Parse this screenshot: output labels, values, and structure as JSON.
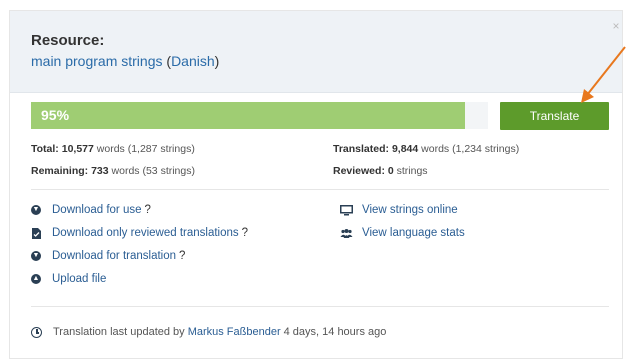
{
  "header": {
    "title": "Resource:",
    "resource_name": "main program strings",
    "language": "Danish",
    "open_paren": "(",
    "close_paren": ")",
    "close_label": "×"
  },
  "progress": {
    "percent_label": "95%",
    "percent_value": 95,
    "fill_color": "#9fcd73"
  },
  "translate_button": {
    "label": "Translate",
    "color": "#5d9b2b"
  },
  "stats": {
    "total_label": "Total:",
    "total_value": "10,577",
    "total_rest": "words (1,287 strings)",
    "remaining_label": "Remaining:",
    "remaining_value": "733",
    "remaining_rest": "words (53 strings)",
    "translated_label": "Translated:",
    "translated_value": "9,844",
    "translated_rest": "words (1,234 strings)",
    "reviewed_label": "Reviewed:",
    "reviewed_value": "0",
    "reviewed_rest": "strings"
  },
  "actions": {
    "download_use": "Download for use",
    "download_reviewed": "Download only reviewed translations",
    "download_translation": "Download for translation",
    "upload": "Upload file",
    "view_online": "View strings online",
    "view_stats": "View language stats",
    "help_mark": "?"
  },
  "footer": {
    "prefix": "Translation last updated by",
    "user": "Markus Faßbender",
    "time": "4 days, 14 hours ago"
  },
  "icons": {
    "download": "download-icon",
    "reviewed": "file-check-icon",
    "upload": "upload-icon",
    "monitor": "monitor-icon",
    "users": "users-icon",
    "clock": "clock-icon",
    "arrow": "annotation-arrow"
  },
  "colors": {
    "link": "#2a5d93",
    "annotation_arrow": "#e8781e",
    "header_bg": "#eef2f6"
  }
}
